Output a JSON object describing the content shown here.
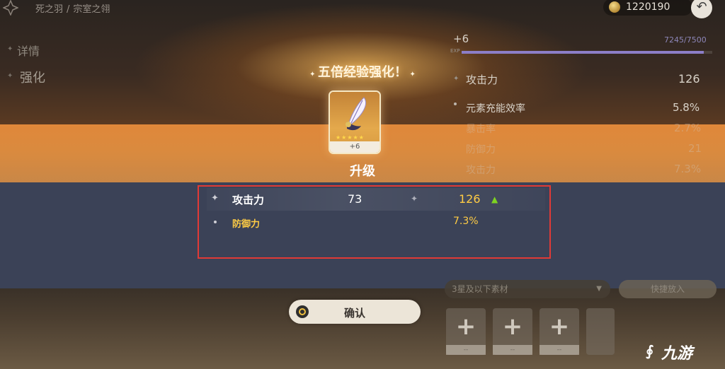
{
  "breadcrumb": {
    "item1": "死之羽",
    "separator": "/",
    "item2": "宗室之翎"
  },
  "currency": {
    "icon": "mora-coin-icon",
    "amount": "1220190"
  },
  "sidebar": {
    "items": [
      {
        "label": "详情"
      },
      {
        "label": "强化"
      }
    ]
  },
  "artifact_panel": {
    "level": "+6",
    "exp_label": "EXP",
    "exp_value": "7245/7500",
    "exp_progress": 0.966,
    "stats": [
      {
        "label": "攻击力",
        "value": "126"
      },
      {
        "label": "元素充能效率",
        "value": "5.8%"
      },
      {
        "label": "暴击率",
        "value": "2.7%"
      },
      {
        "label": "防御力",
        "value": "21"
      },
      {
        "label": "攻击力",
        "value": "7.3%"
      }
    ]
  },
  "popup": {
    "title": "五倍经验强化！",
    "card_level": "+6",
    "card_stars": "★★★★★",
    "heading": "升级",
    "changes": [
      {
        "label": "攻击力",
        "old": "73",
        "new": "126"
      },
      {
        "label": "防御力",
        "new": "7.3%"
      }
    ],
    "confirm_label": "确认"
  },
  "materials": {
    "filter_label": "3星及以下素材",
    "quick_add_label": "快捷放入",
    "slot_empty": "--"
  },
  "watermark": "九游",
  "colors": {
    "highlight_red": "#e03a36",
    "gold": "#ffcc44",
    "up_green": "#7ed321"
  }
}
